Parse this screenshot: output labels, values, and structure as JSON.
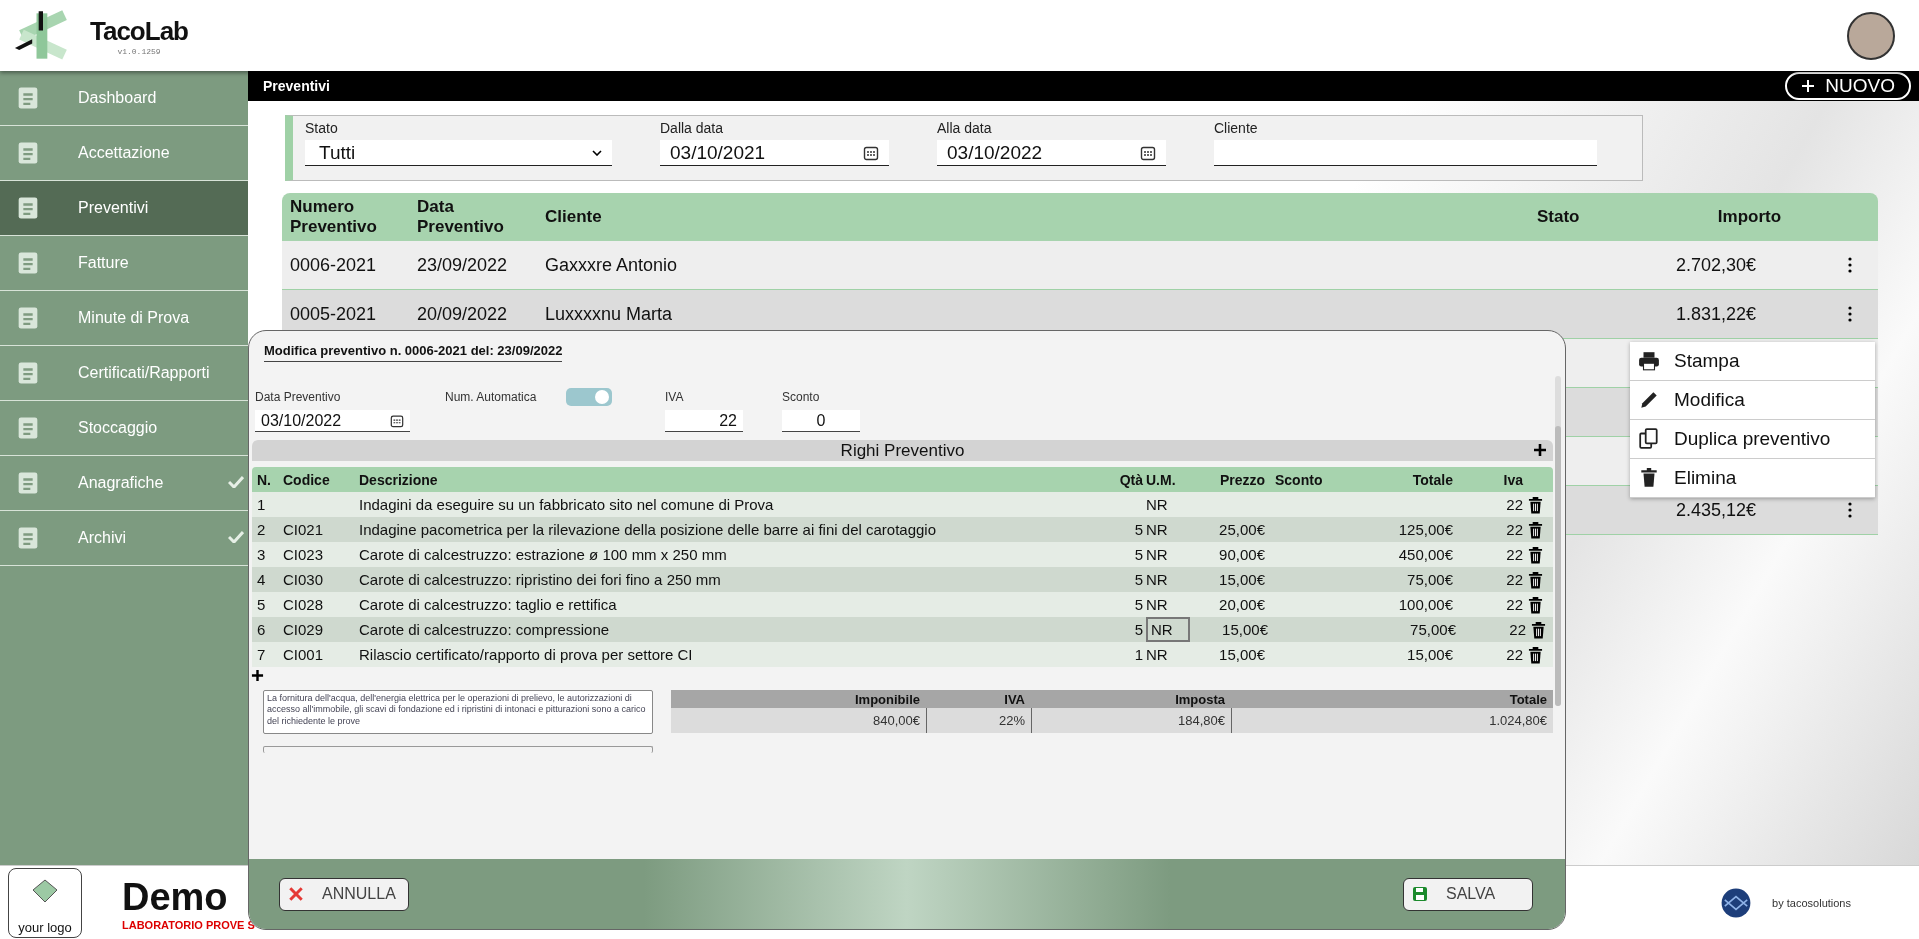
{
  "app": {
    "name": "TacoLab",
    "version": "v1.0.1259"
  },
  "sidebar": {
    "items": [
      {
        "label": "Dashboard",
        "selected": false,
        "expandable": false
      },
      {
        "label": "Accettazione",
        "selected": false,
        "expandable": false
      },
      {
        "label": "Preventivi",
        "selected": true,
        "expandable": false
      },
      {
        "label": "Fatture",
        "selected": false,
        "expandable": false
      },
      {
        "label": "Minute di Prova",
        "selected": false,
        "expandable": false
      },
      {
        "label": "Certificati/Rapporti",
        "selected": false,
        "expandable": false
      },
      {
        "label": "Stoccaggio",
        "selected": false,
        "expandable": false
      },
      {
        "label": "Anagrafiche",
        "selected": false,
        "expandable": true
      },
      {
        "label": "Archivi",
        "selected": false,
        "expandable": true
      }
    ]
  },
  "page": {
    "title": "Preventivi",
    "new_button": "NUOVO"
  },
  "filters": {
    "stato": {
      "label": "Stato",
      "value": "Tutti"
    },
    "dalla": {
      "label": "Dalla data",
      "value": "03/10/2021"
    },
    "alla": {
      "label": "Alla data",
      "value": "03/10/2022"
    },
    "cliente": {
      "label": "Cliente"
    }
  },
  "table": {
    "columns": [
      "Numero Preventivo",
      "Data Preventivo",
      "Cliente",
      "Stato",
      "Importo"
    ],
    "rows": [
      {
        "numero": "0006-2021",
        "data": "23/09/2022",
        "cliente": "Gaxxxre Antonio",
        "importo": "2.702,30€"
      },
      {
        "numero": "0005-2021",
        "data": "20/09/2022",
        "cliente": "Luxxxxnu Marta",
        "importo": "1.831,22€"
      },
      {},
      {},
      {},
      {
        "importo": "2.435,12€"
      }
    ]
  },
  "context_menu": [
    "Stampa",
    "Modifica",
    "Duplica preventivo",
    "Elimina"
  ],
  "modal": {
    "title": "Modifica preventivo n. 0006-2021 del: 23/09/2022",
    "data_label": "Data Preventivo",
    "data_value": "03/10/2022",
    "auto_label": "Num. Automatica",
    "auto_on": true,
    "iva_label": "IVA",
    "iva_value": "22",
    "sconto_label": "Sconto",
    "sconto_value": "0",
    "section_title": "Righi Preventivo",
    "columns": [
      "N.",
      "Codice",
      "Descrizione",
      "Qtà",
      "U.M.",
      "Prezzo",
      "Sconto",
      "Totale",
      "Iva"
    ],
    "rows": [
      {
        "n": "1",
        "descrizione": "Indagini da eseguire su un fabbricato sito nel comune di Prova",
        "um": "NR",
        "iva": "22",
        "editing": false
      },
      {
        "n": "2",
        "codice": "CI021",
        "descrizione": "Indagine pacometrica per la rilevazione della posizione delle barre ai fini del carotaggio",
        "qta": "5",
        "um": "NR",
        "prezzo": "25,00€",
        "totale": "125,00€",
        "iva": "22",
        "editing": false
      },
      {
        "n": "3",
        "codice": "CI023",
        "descrizione": "Carote di calcestruzzo: estrazione ø 100 mm x 250 mm",
        "qta": "5",
        "um": "NR",
        "prezzo": "90,00€",
        "totale": "450,00€",
        "iva": "22",
        "editing": false
      },
      {
        "n": "4",
        "codice": "CI030",
        "descrizione": "Carote di calcestruzzo: ripristino dei fori fino a 250 mm",
        "qta": "5",
        "um": "NR",
        "prezzo": "15,00€",
        "totale": "75,00€",
        "iva": "22",
        "editing": false
      },
      {
        "n": "5",
        "codice": "CI028",
        "descrizione": "Carote di calcestruzzo: taglio e rettifica",
        "qta": "5",
        "um": "NR",
        "prezzo": "20,00€",
        "totale": "100,00€",
        "iva": "22",
        "editing": false
      },
      {
        "n": "6",
        "codice": "CI029",
        "descrizione": "Carote di calcestruzzo: compressione",
        "qta": "5",
        "um": "NR",
        "prezzo": "15,00€",
        "totale": "75,00€",
        "iva": "22",
        "editing": true
      },
      {
        "n": "7",
        "codice": "CI001",
        "descrizione": "Rilascio certificato/rapporto di prova per settore CI",
        "qta": "1",
        "um": "NR",
        "prezzo": "15,00€",
        "totale": "15,00€",
        "iva": "22",
        "editing": false
      }
    ],
    "notes": "La fornitura dell'acqua, dell'energia elettrica per le operazioni di prelievo, le autorizzazioni di accesso all'immobile, gli scavi di fondazione ed i ripristini di intonaci e pitturazioni sono a carico del richiedente le prove",
    "totals": {
      "columns": [
        "Imponibile",
        "IVA",
        "Imposta",
        "Totale"
      ],
      "values": [
        "840,00€",
        "22%",
        "184,80€",
        "1.024,80€"
      ]
    },
    "cancel": "ANNULLA",
    "save": "SALVA"
  },
  "footer": {
    "logo": "your logo",
    "company": "Demo",
    "subtitle": "LABORATORIO PROVE S",
    "credit": "by tacosolutions"
  }
}
